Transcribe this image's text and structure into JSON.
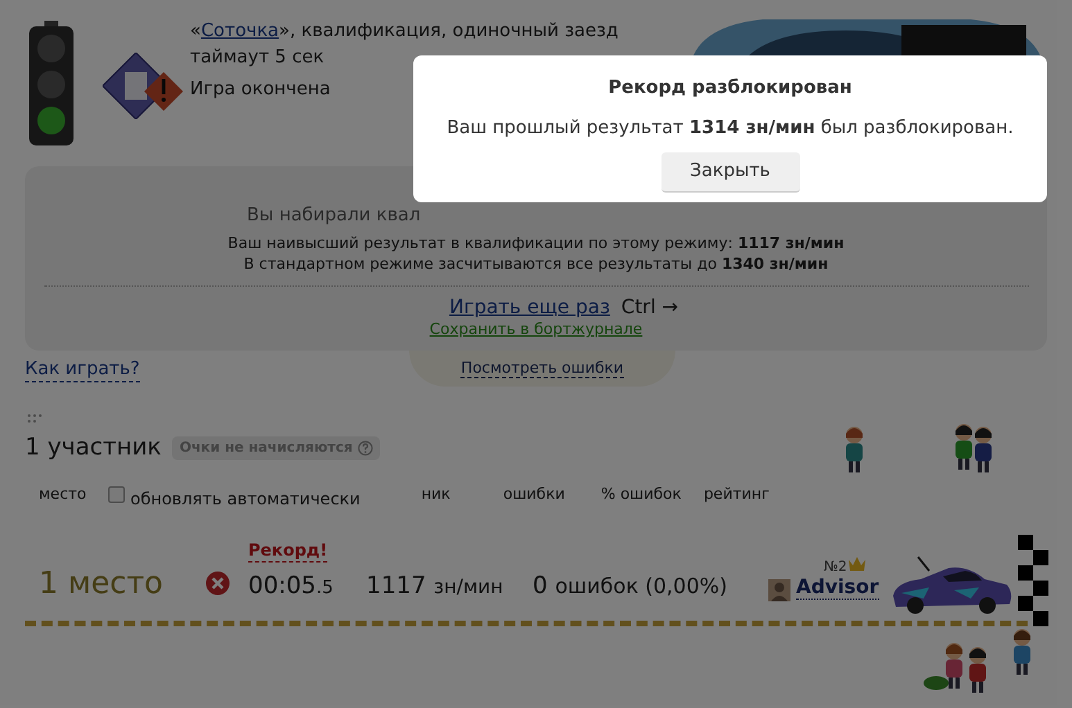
{
  "header": {
    "quote_open": "«",
    "mode_link": "Соточка",
    "title_rest": "», квалификация, одиночный заезд",
    "timeout": "таймаут 5 сек",
    "status": "Игра окончена"
  },
  "result_panel": {
    "intro": "Вы набирали квал",
    "best": "Ваш наивысший результат в квалификации по этому режиму: **1117 зн/мин**",
    "limit": "В стандартном режиме засчитываются все результаты до **1340 зн/мин**",
    "play_again": "Играть еще раз",
    "shortcut": "Ctrl →",
    "save_link": "Сохранить в бортжурнале"
  },
  "how_to_play": "Как играть?",
  "errors_tab": "Посмотреть ошибки",
  "participants": {
    "count": "1 участник",
    "badge": "Очки не начисляются"
  },
  "columns": {
    "place": "место",
    "auto_update": {
      "label": "обновлять автоматически",
      "checked": false
    },
    "nick": "ник",
    "errors": "ошибки",
    "error_percent": "% ошибок",
    "rating": "рейтинг"
  },
  "rows": [
    {
      "place": "1 место",
      "record": "Рекорд!",
      "time": "00:05",
      "time_fraction": ".5",
      "speed": "1117",
      "speed_unit": "зн/мин",
      "errors": "0",
      "errors_detail": "ошибок (0,00%)",
      "rank": "№2",
      "player": "Advisor"
    }
  ],
  "dialog": {
    "title": "Рекорд разблокирован",
    "message": "Ваш прошлый результат **1314 зн/мин** был разблокирован.",
    "close_button": "Закрыть"
  }
}
